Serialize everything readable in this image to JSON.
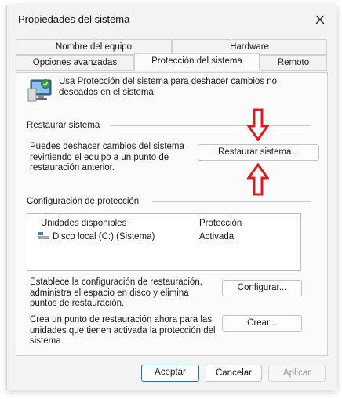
{
  "window": {
    "title": "Propiedades del sistema"
  },
  "tabs": [
    {
      "label": "Nombre del equipo"
    },
    {
      "label": "Hardware"
    },
    {
      "label": "Opciones avanzadas"
    },
    {
      "label": "Protección del sistema"
    },
    {
      "label": "Remoto"
    }
  ],
  "intro": {
    "text": "Usa Protección del sistema para deshacer cambios no deseados en el sistema."
  },
  "restore": {
    "heading": "Restaurar sistema",
    "text": "Puedes deshacer cambios del sistema revirtiendo el equipo a un punto de restauración anterior.",
    "button": "Restaurar sistema..."
  },
  "protection": {
    "heading": "Configuración de protección",
    "columns": [
      "Unidades disponibles",
      "Protección"
    ],
    "rows": [
      {
        "drive": "Disco local (C:) (Sistema)",
        "status": "Activada"
      }
    ],
    "configure_text": "Establece la configuración de restauración, administra el espacio en disco y elimina puntos de restauración.",
    "configure_button": "Configurar...",
    "create_text": "Crea un punto de restauración ahora para las unidades que tienen activada la protección del sistema.",
    "create_button": "Crear..."
  },
  "footer": {
    "ok": "Aceptar",
    "cancel": "Cancelar",
    "apply": "Aplicar"
  },
  "colors": {
    "arrow": "#e0191d",
    "primary_border": "#1f6fbd"
  }
}
